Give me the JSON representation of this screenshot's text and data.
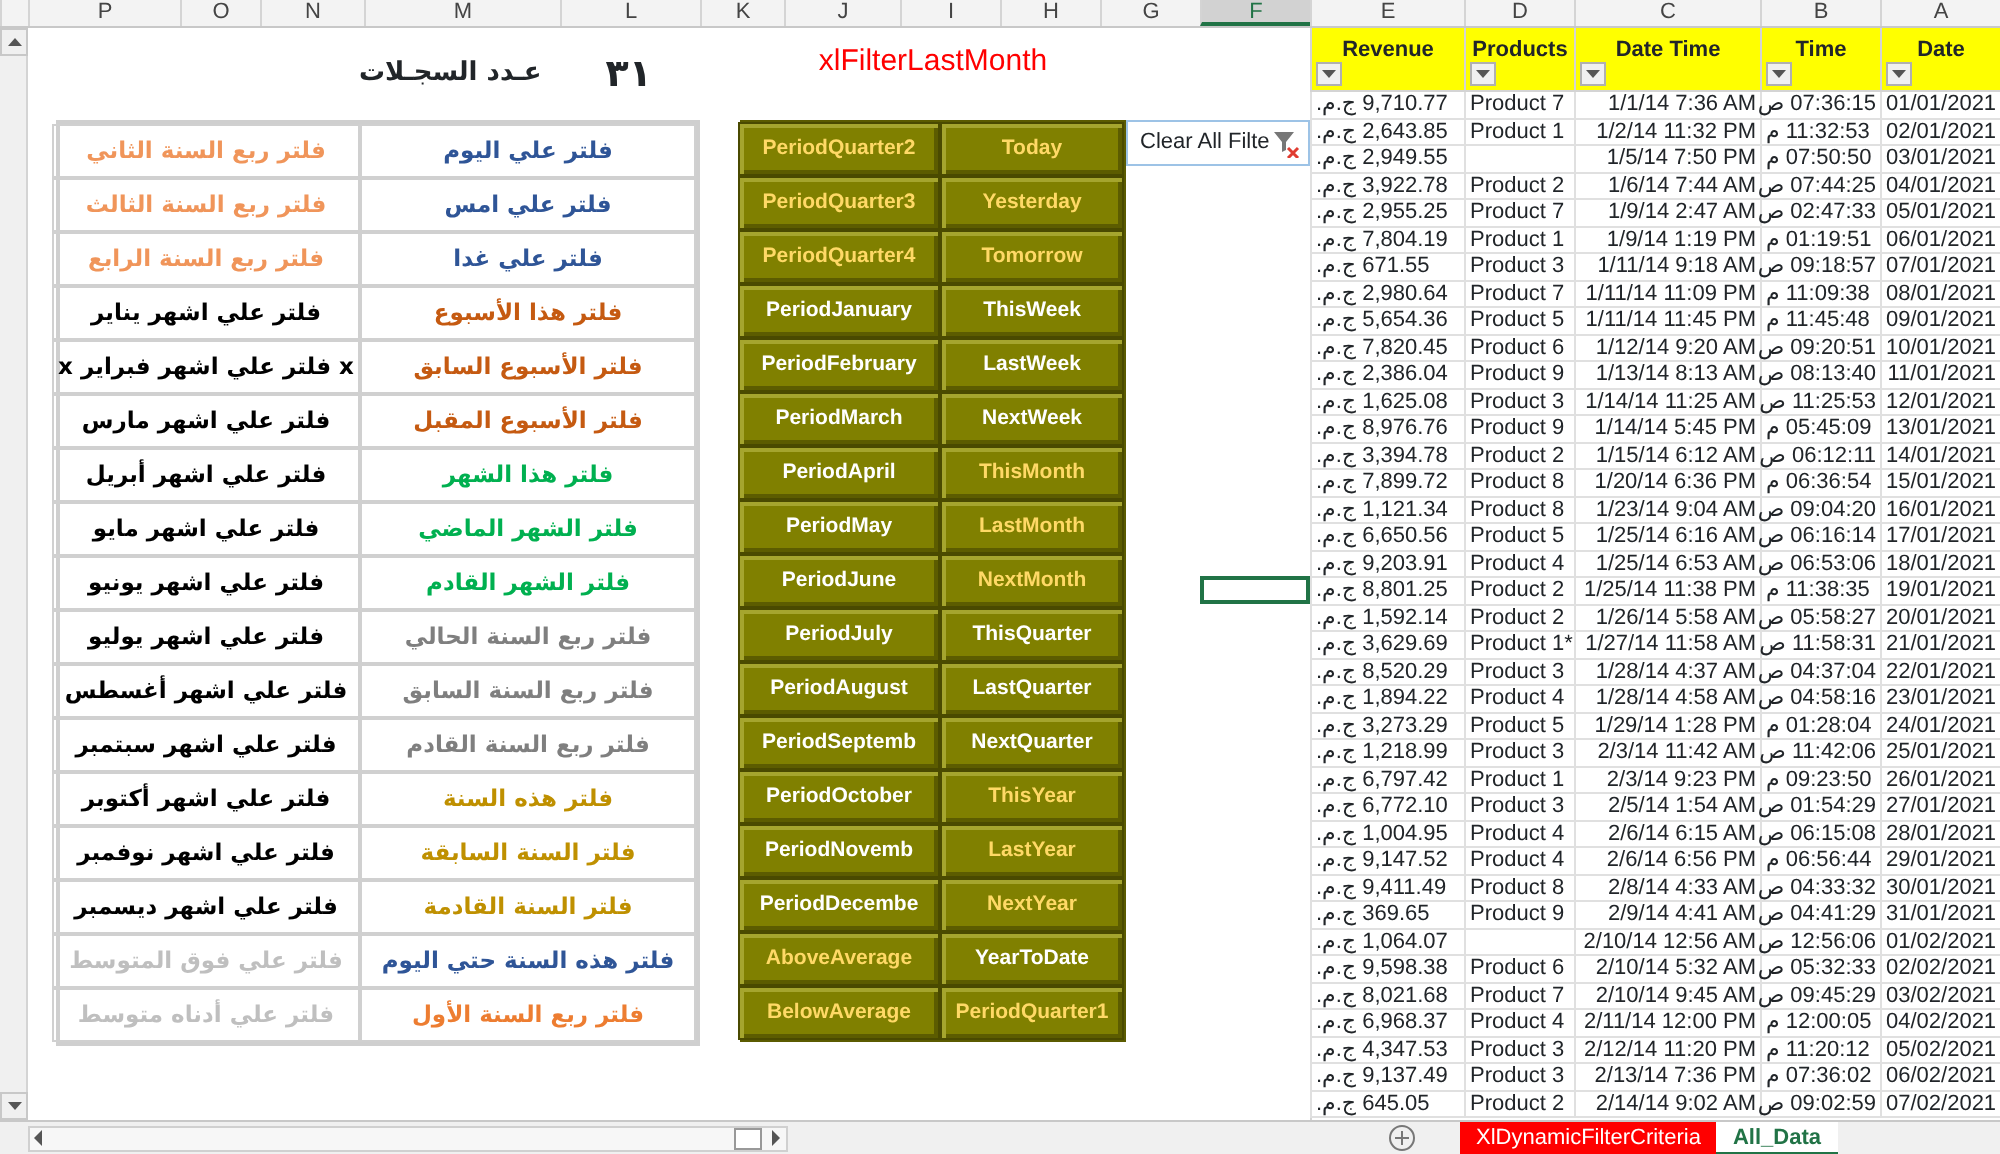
{
  "column_headers": [
    {
      "label": "A",
      "selected": false
    },
    {
      "label": "B",
      "selected": false
    },
    {
      "label": "C",
      "selected": false
    },
    {
      "label": "D",
      "selected": false
    },
    {
      "label": "E",
      "selected": false
    },
    {
      "label": "F",
      "selected": true
    },
    {
      "label": "G",
      "selected": false
    },
    {
      "label": "H",
      "selected": false
    },
    {
      "label": "I",
      "selected": false
    },
    {
      "label": "J",
      "selected": false
    },
    {
      "label": "K",
      "selected": false
    },
    {
      "label": "L",
      "selected": false
    },
    {
      "label": "M",
      "selected": false
    },
    {
      "label": "N",
      "selected": false
    },
    {
      "label": "O",
      "selected": false
    },
    {
      "label": "P",
      "selected": false
    }
  ],
  "record_count": {
    "value": "٣١",
    "label": "عـدد السجـلات"
  },
  "criteria_title": "xlFilterLastMonth",
  "filter_rows": [
    {
      "left": {
        "text": "فلتر ربع السنة الثاني",
        "color": "#f0955a"
      },
      "right": {
        "text": "فلتر علي اليوم",
        "color": "#2f5597"
      }
    },
    {
      "left": {
        "text": "فلتر ربع السنة الثالث",
        "color": "#f0955a"
      },
      "right": {
        "text": "فلتر علي امس",
        "color": "#2f5597"
      }
    },
    {
      "left": {
        "text": "فلتر ربع السنة الرابع",
        "color": "#f0955a"
      },
      "right": {
        "text": "فلتر علي غدا",
        "color": "#2f5597"
      }
    },
    {
      "left": {
        "text": "فلتر علي اشهر يناير",
        "color": "#000000"
      },
      "right": {
        "text": "فلتر هذا الأسبوع",
        "color": "#c55a11"
      }
    },
    {
      "left": {
        "text": "x فلتر علي اشهر فبراير x",
        "color": "#000000"
      },
      "right": {
        "text": "فلتر الأسبوع السابق",
        "color": "#c55a11"
      }
    },
    {
      "left": {
        "text": "فلتر علي اشهر مارس",
        "color": "#000000"
      },
      "right": {
        "text": "فلتر الأسبوع المقبل",
        "color": "#c55a11"
      }
    },
    {
      "left": {
        "text": "فلتر علي اشهر أبريل",
        "color": "#000000"
      },
      "right": {
        "text": "فلتر هذا الشهر",
        "color": "#00b050"
      }
    },
    {
      "left": {
        "text": "فلتر علي اشهر مايو",
        "color": "#000000"
      },
      "right": {
        "text": "فلتر الشهر الماضي",
        "color": "#00b050"
      }
    },
    {
      "left": {
        "text": "فلتر علي اشهر يونيو",
        "color": "#000000"
      },
      "right": {
        "text": "فلتر الشهر القادم",
        "color": "#00b050"
      }
    },
    {
      "left": {
        "text": "فلتر علي اشهر يوليو",
        "color": "#000000"
      },
      "right": {
        "text": "فلتر ربع السنة الحالي",
        "color": "#7f7f7f"
      }
    },
    {
      "left": {
        "text": "فلتر علي اشهر أغسطس",
        "color": "#000000"
      },
      "right": {
        "text": "فلتر ربع السنة السابق",
        "color": "#7f7f7f"
      }
    },
    {
      "left": {
        "text": "فلتر علي اشهر سبتمبر",
        "color": "#000000"
      },
      "right": {
        "text": "فلتر ربع السنة القادم",
        "color": "#7f7f7f"
      }
    },
    {
      "left": {
        "text": "فلتر علي اشهر أكتوبر",
        "color": "#000000"
      },
      "right": {
        "text": "فلتر هذه السنة",
        "color": "#bf9000"
      }
    },
    {
      "left": {
        "text": "فلتر علي اشهر نوفمبر",
        "color": "#000000"
      },
      "right": {
        "text": "فلتر السنة السابقة",
        "color": "#bf9000"
      }
    },
    {
      "left": {
        "text": "فلتر علي اشهر ديسمبر",
        "color": "#000000"
      },
      "right": {
        "text": "فلتر السنة القادمة",
        "color": "#bf9000"
      }
    },
    {
      "left": {
        "text": "فلتر علي فوق المتوسط",
        "color": "#bfbfbf"
      },
      "right": {
        "text": "فلتر هذه السنة حتي اليوم",
        "color": "#2f5597"
      }
    },
    {
      "left": {
        "text": "فلتر علي أدناه متوسط",
        "color": "#bfbfbf"
      },
      "right": {
        "text": "فلتر ربع السنة الأول",
        "color": "#ed7d31"
      }
    }
  ],
  "filter_buttons": [
    {
      "label": "Today",
      "color": "#ffd966"
    },
    {
      "label": "PeriodQuarter2",
      "color": "#ffd966"
    },
    {
      "label": "Yesterday",
      "color": "#ffd966"
    },
    {
      "label": "PeriodQuarter3",
      "color": "#ffd966"
    },
    {
      "label": "Tomorrow",
      "color": "#ffd966"
    },
    {
      "label": "PeriodQuarter4",
      "color": "#ffd966"
    },
    {
      "label": "ThisWeek",
      "color": "#ffffff"
    },
    {
      "label": "PeriodJanuary",
      "color": "#ffffff"
    },
    {
      "label": "LastWeek",
      "color": "#ffffff"
    },
    {
      "label": "PeriodFebruary",
      "color": "#ffffff"
    },
    {
      "label": "NextWeek",
      "color": "#ffffff"
    },
    {
      "label": "PeriodMarch",
      "color": "#ffffff"
    },
    {
      "label": "ThisMonth",
      "color": "#ffd966"
    },
    {
      "label": "PeriodApril",
      "color": "#ffffff"
    },
    {
      "label": "LastMonth",
      "color": "#ffd966"
    },
    {
      "label": "PeriodMay",
      "color": "#ffffff"
    },
    {
      "label": "NextMonth",
      "color": "#ffd966"
    },
    {
      "label": "PeriodJune",
      "color": "#ffffff"
    },
    {
      "label": "ThisQuarter",
      "color": "#ffffff"
    },
    {
      "label": "PeriodJuly",
      "color": "#ffffff"
    },
    {
      "label": "LastQuarter",
      "color": "#ffffff"
    },
    {
      "label": "PeriodAugust",
      "color": "#ffffff"
    },
    {
      "label": "NextQuarter",
      "color": "#ffffff"
    },
    {
      "label": "PeriodSeptemb",
      "color": "#ffffff"
    },
    {
      "label": "ThisYear",
      "color": "#ffd966"
    },
    {
      "label": "PeriodOctober",
      "color": "#ffffff"
    },
    {
      "label": "LastYear",
      "color": "#ffd966"
    },
    {
      "label": "PeriodNovemb",
      "color": "#ffffff"
    },
    {
      "label": "NextYear",
      "color": "#ffd966"
    },
    {
      "label": "PeriodDecembe",
      "color": "#ffffff"
    },
    {
      "label": "YearToDate",
      "color": "#ffffff"
    },
    {
      "label": "AboveAverage",
      "color": "#ffd966"
    },
    {
      "label": "PeriodQuarter1",
      "color": "#ffd966"
    },
    {
      "label": "BelowAverage",
      "color": "#ffd966"
    }
  ],
  "clear_button": {
    "label": "Clear All Filte"
  },
  "table": {
    "columns": [
      "Date",
      "Time",
      "Date Time",
      "Products",
      "Revenue"
    ],
    "rows": [
      {
        "date": "01/01/2021",
        "time": "07:36:15 ص",
        "date_time": "1/1/14 7:36 AM",
        "product": "Product 7",
        "revenue": "9,710.77 ج.م."
      },
      {
        "date": "02/01/2021",
        "time": "11:32:53 م",
        "date_time": "1/2/14 11:32 PM",
        "product": "Product 1",
        "revenue": "2,643.85 ج.م."
      },
      {
        "date": "03/01/2021",
        "time": "07:50:50 م",
        "date_time": "1/5/14 7:50 PM",
        "revenue": "2,949.55 ج.م."
      },
      {
        "date": "04/01/2021",
        "time": "07:44:25 ص",
        "date_time": "1/6/14 7:44 AM",
        "product": "Product 2",
        "revenue": "3,922.78 ج.م."
      },
      {
        "date": "05/01/2021",
        "time": "02:47:33 ص",
        "date_time": "1/9/14 2:47 AM",
        "product": "Product 7",
        "revenue": "2,955.25 ج.م."
      },
      {
        "date": "06/01/2021",
        "time": "01:19:51 م",
        "date_time": "1/9/14 1:19 PM",
        "product": "Product 1",
        "revenue": "7,804.19 ج.م."
      },
      {
        "date": "07/01/2021",
        "time": "09:18:57 ص",
        "date_time": "1/11/14 9:18 AM",
        "product": "Product 3",
        "revenue": "671.55 ج.م."
      },
      {
        "date": "08/01/2021",
        "time": "11:09:38 م",
        "date_time": "1/11/14 11:09 PM",
        "product": "Product 7",
        "revenue": "2,980.64 ج.م."
      },
      {
        "date": "09/01/2021",
        "time": "11:45:48 م",
        "date_time": "1/11/14 11:45 PM",
        "product": "Product 5",
        "revenue": "5,654.36 ج.م."
      },
      {
        "date": "10/01/2021",
        "time": "09:20:51 ص",
        "date_time": "1/12/14 9:20 AM",
        "product": "Product 6",
        "revenue": "7,820.45 ج.م."
      },
      {
        "date": "11/01/2021",
        "time": "08:13:40 ص",
        "date_time": "1/13/14 8:13 AM",
        "product": "Product 9",
        "revenue": "2,386.04 ج.م."
      },
      {
        "date": "12/01/2021",
        "time": "11:25:53 ص",
        "date_time": "1/14/14 11:25 AM",
        "product": "Product 3",
        "revenue": "1,625.08 ج.م."
      },
      {
        "date": "13/01/2021",
        "time": "05:45:09 م",
        "date_time": "1/14/14 5:45 PM",
        "product": "Product 9",
        "revenue": "8,976.76 ج.م."
      },
      {
        "date": "14/01/2021",
        "time": "06:12:11 ص",
        "date_time": "1/15/14 6:12 AM",
        "product": "Product 2",
        "revenue": "3,394.78 ج.م."
      },
      {
        "date": "15/01/2021",
        "time": "06:36:54 م",
        "date_time": "1/20/14 6:36 PM",
        "product": "Product 8",
        "revenue": "7,899.72 ج.م."
      },
      {
        "date": "16/01/2021",
        "time": "09:04:20 ص",
        "date_time": "1/23/14 9:04 AM",
        "product": "Product 8",
        "revenue": "1,121.34 ج.م."
      },
      {
        "date": "17/01/2021",
        "time": "06:16:14 ص",
        "date_time": "1/25/14 6:16 AM",
        "product": "Product 5",
        "revenue": "6,650.56 ج.م."
      },
      {
        "date": "18/01/2021",
        "time": "06:53:06 ص",
        "date_time": "1/25/14 6:53 AM",
        "product": "Product 4",
        "revenue": "9,203.91 ج.م."
      },
      {
        "date": "19/01/2021",
        "time": "11:38:35 م",
        "date_time": "1/25/14 11:38 PM",
        "product": "Product 2",
        "revenue": "8,801.25 ج.م."
      },
      {
        "date": "20/01/2021",
        "time": "05:58:27 ص",
        "date_time": "1/26/14 5:58 AM",
        "product": "Product 2",
        "revenue": "1,592.14 ج.م."
      },
      {
        "date": "21/01/2021",
        "time": "11:58:31 ص",
        "date_time": "1/27/14 11:58 AM",
        "product": "Product 1*",
        "revenue": "3,629.69 ج.م."
      },
      {
        "date": "22/01/2021",
        "time": "04:37:04 ص",
        "date_time": "1/28/14 4:37 AM",
        "product": "Product 3",
        "revenue": "8,520.29 ج.م."
      },
      {
        "date": "23/01/2021",
        "time": "04:58:16 ص",
        "date_time": "1/28/14 4:58 AM",
        "product": "Product 4",
        "revenue": "1,894.22 ج.م."
      },
      {
        "date": "24/01/2021",
        "time": "01:28:04 م",
        "date_time": "1/29/14 1:28 PM",
        "product": "Product 5",
        "revenue": "3,273.29 ج.م."
      },
      {
        "date": "25/01/2021",
        "time": "11:42:06 ص",
        "date_time": "2/3/14 11:42 AM",
        "product": "Product 3",
        "revenue": "1,218.99 ج.م."
      },
      {
        "date": "26/01/2021",
        "time": "09:23:50 م",
        "date_time": "2/3/14 9:23 PM",
        "product": "Product 1",
        "revenue": "6,797.42 ج.م."
      },
      {
        "date": "27/01/2021",
        "time": "01:54:29 ص",
        "date_time": "2/5/14 1:54 AM",
        "product": "Product 3",
        "revenue": "6,772.10 ج.م."
      },
      {
        "date": "28/01/2021",
        "time": "06:15:08 ص",
        "date_time": "2/6/14 6:15 AM",
        "product": "Product 4",
        "revenue": "1,004.95 ج.م."
      },
      {
        "date": "29/01/2021",
        "time": "06:56:44 م",
        "date_time": "2/6/14 6:56 PM",
        "product": "Product 4",
        "revenue": "9,147.52 ج.م."
      },
      {
        "date": "30/01/2021",
        "time": "04:33:32 ص",
        "date_time": "2/8/14 4:33 AM",
        "product": "Product 8",
        "revenue": "9,411.49 ج.م."
      },
      {
        "date": "31/01/2021",
        "time": "04:41:29 ص",
        "date_time": "2/9/14 4:41 AM",
        "product": "Product 9",
        "revenue": "369.65 ج.م."
      },
      {
        "date": "01/02/2021",
        "time": "12:56:06 ص",
        "date_time": "2/10/14 12:56 AM",
        "revenue": "1,064.07 ج.م."
      },
      {
        "date": "02/02/2021",
        "time": "05:32:33 ص",
        "date_time": "2/10/14 5:32 AM",
        "product": "Product 6",
        "revenue": "9,598.38 ج.م."
      },
      {
        "date": "03/02/2021",
        "time": "09:45:29 ص",
        "date_time": "2/10/14 9:45 AM",
        "product": "Product 7",
        "revenue": "8,021.68 ج.م."
      },
      {
        "date": "04/02/2021",
        "time": "12:00:05 م",
        "date_time": "2/11/14 12:00 PM",
        "product": "Product 4",
        "revenue": "6,968.37 ج.م."
      },
      {
        "date": "05/02/2021",
        "time": "11:20:12 م",
        "date_time": "2/12/14 11:20 PM",
        "product": "Product 3",
        "revenue": "4,347.53 ج.م."
      },
      {
        "date": "06/02/2021",
        "time": "07:36:02 م",
        "date_time": "2/13/14 7:36 PM",
        "product": "Product 3",
        "revenue": "9,137.49 ج.م."
      },
      {
        "date": "07/02/2021",
        "time": "09:02:59 ص",
        "date_time": "2/14/14 9:02 AM",
        "product": "Product 2",
        "revenue": "645.05 ج.م."
      }
    ]
  },
  "sheet_tabs": [
    {
      "label": "All_Data",
      "selected": true
    },
    {
      "label": "XlDynamicFilterCriteria",
      "selected": false,
      "color": "#ff0000"
    }
  ]
}
